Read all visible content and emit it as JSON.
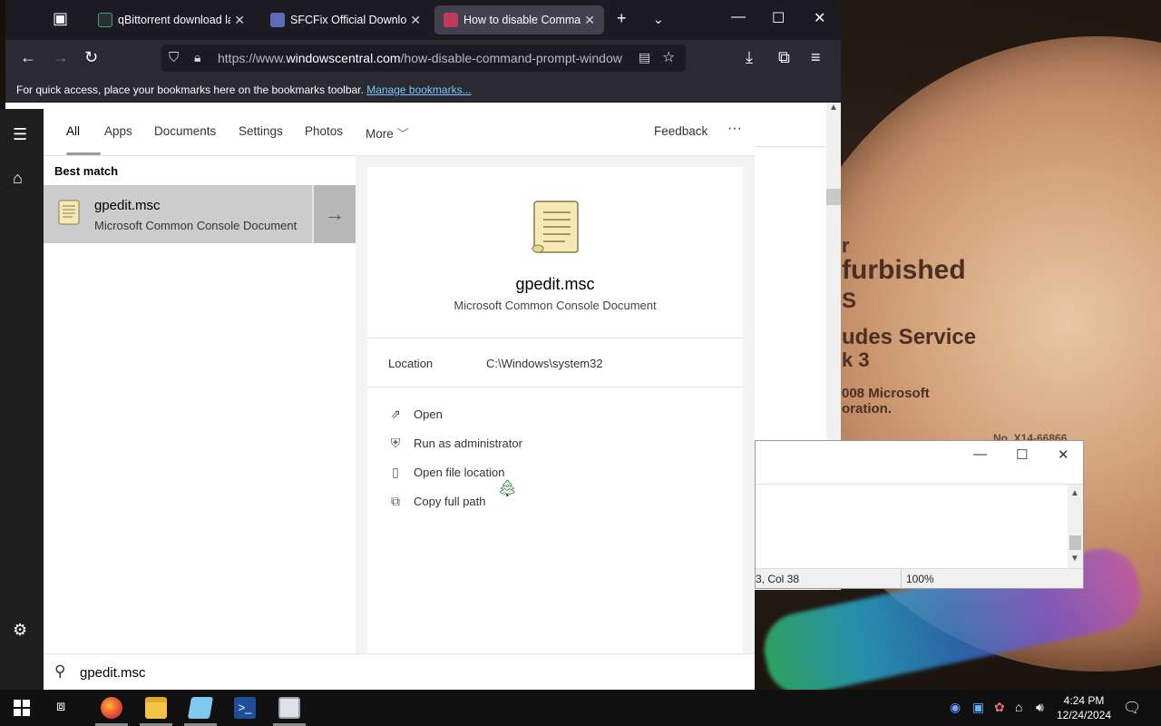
{
  "browser": {
    "tabs": [
      {
        "label": "qBittorrent download late",
        "active": false
      },
      {
        "label": "SFCFix Official Download",
        "active": false
      },
      {
        "label": "How to disable Comman",
        "active": true
      }
    ],
    "url_prefix": "https://www.",
    "url_domain": "windowscentral.com",
    "url_path": "/how-disable-command-prompt-window",
    "bookmark_prompt": "For quick access, place your bookmarks here on the bookmarks toolbar.",
    "bookmark_link": "Manage bookmarks..."
  },
  "search_panel": {
    "tabs": [
      "All",
      "Apps",
      "Documents",
      "Settings",
      "Photos",
      "More"
    ],
    "feedback": "Feedback",
    "more_options": "···",
    "best_match_label": "Best match",
    "result": {
      "title": "gpedit.msc",
      "subtitle": "Microsoft Common Console Document"
    },
    "detail": {
      "title": "gpedit.msc",
      "subtitle": "Microsoft Common Console Document",
      "location_label": "Location",
      "location_value": "C:\\Windows\\system32",
      "actions": [
        "Open",
        "Run as administrator",
        "Open file location",
        "Copy full path"
      ]
    },
    "query": "gpedit.msc"
  },
  "notepad": {
    "status_position": "3, Col 38",
    "status_zoom": "100%"
  },
  "wallpaper": {
    "lines": [
      "r",
      "furbished",
      "S",
      "udes Service",
      "k 3",
      "008 Microsoft",
      "oration.",
      "No. X14-66866"
    ]
  },
  "taskbar": {
    "time": "4:24 PM",
    "date": "12/24/2024"
  },
  "colors": {
    "accent_link": "#75c8ff",
    "browser_dark": "#1c1b22",
    "search_selected": "#cccccc"
  }
}
